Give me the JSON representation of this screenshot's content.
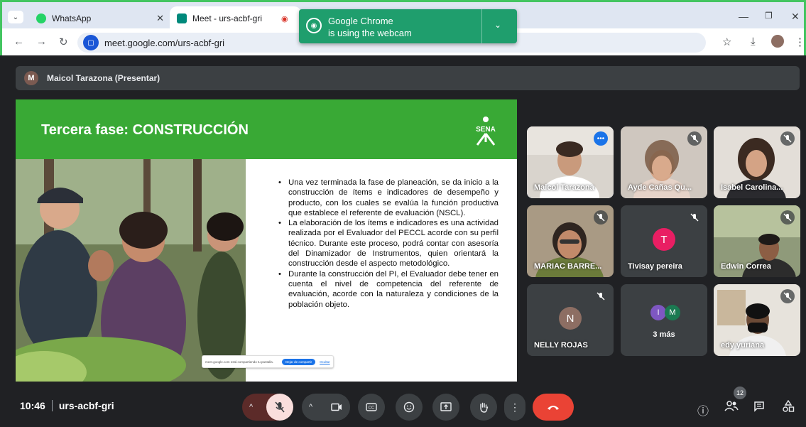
{
  "browser": {
    "tabs": [
      {
        "label": "WhatsApp",
        "icon": "whatsapp-icon"
      },
      {
        "label": "Meet - urs-acbf-gri",
        "icon": "meet-icon"
      }
    ],
    "url": "meet.google.com/urs-acbf-gri",
    "webcam_notice": {
      "line1": "Google Chrome",
      "line2": "is using the webcam"
    }
  },
  "presenter_bar": {
    "initial": "M",
    "label": "Maicol Tarazona (Presentar)"
  },
  "slide": {
    "title": "Tercera fase: CONSTRUCCIÓN",
    "logo_text": "SENA",
    "bullets": [
      "Una vez terminada la fase de planeación, se da inicio a la construcción de ítems e indicadores de desempeño y producto, con los cuales se evalúa la función productiva que establece el referente de evaluación (NSCL).",
      "La elaboración de los ítems e indicadores es una actividad realizada por el Evaluador del PECCL acorde con su perfil técnico. Durante este proceso, podrá contar con asesoría del Dinamizador de Instrumentos, quien orientará la construcción desde el aspecto metodológico.",
      "Durante la construcción del PI, el Evaluador debe tener en cuenta el nivel de competencia del referente de evaluación, acorde con la naturaleza y condiciones de la población objeto."
    ],
    "share_bar": {
      "text": "meet.google.com está compartiendo tu pantalla.",
      "stop_label": "Dejar de compartir",
      "hide_label": "Ocultar"
    }
  },
  "participants": [
    {
      "name": "Maicol Tarazona",
      "speaking": true
    },
    {
      "name": "Ayde Cañas Qu...",
      "muted": true
    },
    {
      "name": "Isabel Carolina...",
      "muted": true
    },
    {
      "name": "MARIAC BARRE...",
      "muted": true
    },
    {
      "name": "Tivisay pereira",
      "initial": "T",
      "color": "#e91e63",
      "muted": true
    },
    {
      "name": "Edwin Correa",
      "muted": true
    },
    {
      "name": "NELLY ROJAS",
      "initial": "N",
      "color": "#8d6e63",
      "muted": true
    },
    {
      "more_label": "3 más",
      "avatars": [
        {
          "initial": "I",
          "color": "#7e57c2"
        },
        {
          "initial": "M",
          "color": "#1b7a52"
        }
      ]
    },
    {
      "name": "edy yuriana",
      "muted": true
    }
  ],
  "bottom": {
    "time": "10:46",
    "meeting_code": "urs-acbf-gri",
    "participant_count": "12"
  },
  "colors": {
    "accent_green": "#39a935",
    "end_call_red": "#ea4335",
    "border_green": "#43c561"
  }
}
